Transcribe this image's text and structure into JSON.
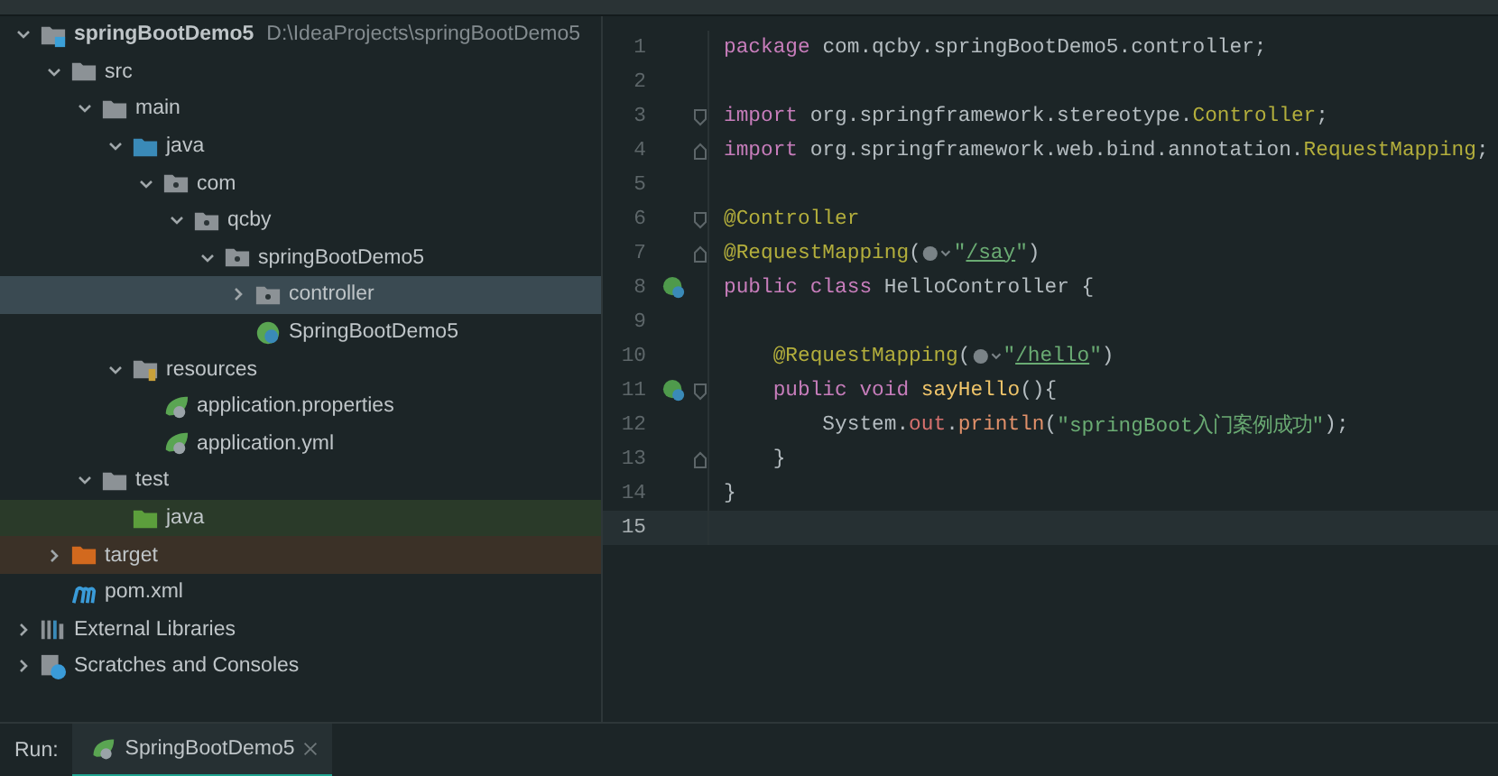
{
  "project_tree": {
    "items": [
      {
        "name": "springBootDemo5",
        "path": "D:\\IdeaProjects\\springBootDemo5",
        "kind": "module",
        "expanded": true,
        "selected": false,
        "children": [
          {
            "name": "src",
            "kind": "folder",
            "expanded": true,
            "selected": false,
            "children": [
              {
                "name": "main",
                "kind": "folder",
                "expanded": true,
                "selected": false,
                "children": [
                  {
                    "name": "java",
                    "kind": "source",
                    "expanded": true,
                    "selected": false,
                    "children": [
                      {
                        "name": "com",
                        "kind": "package",
                        "expanded": true,
                        "selected": false,
                        "children": [
                          {
                            "name": "qcby",
                            "kind": "package",
                            "expanded": true,
                            "selected": false,
                            "children": [
                              {
                                "name": "springBootDemo5",
                                "kind": "package",
                                "expanded": true,
                                "selected": false,
                                "children": [
                                  {
                                    "name": "controller",
                                    "kind": "package",
                                    "expanded": false,
                                    "selected": true
                                  },
                                  {
                                    "name": "SpringBootDemo5",
                                    "kind": "class",
                                    "selected": false
                                  }
                                ]
                              }
                            ]
                          }
                        ]
                      }
                    ]
                  },
                  {
                    "name": "resources",
                    "kind": "resources",
                    "expanded": true,
                    "selected": false,
                    "children": [
                      {
                        "name": "application.properties",
                        "kind": "config",
                        "selected": false
                      },
                      {
                        "name": "application.yml",
                        "kind": "config",
                        "selected": false
                      }
                    ]
                  }
                ]
              },
              {
                "name": "test",
                "kind": "folder",
                "expanded": true,
                "selected": false,
                "children": [
                  {
                    "name": "java",
                    "kind": "test-source",
                    "selected": false
                  }
                ]
              }
            ]
          },
          {
            "name": "target",
            "kind": "excluded",
            "expanded": false,
            "selected": false
          },
          {
            "name": "pom.xml",
            "kind": "maven",
            "selected": false
          }
        ]
      },
      {
        "name": "External Libraries",
        "kind": "libraries",
        "expanded": false,
        "selected": false
      },
      {
        "name": "Scratches and Consoles",
        "kind": "scratches",
        "expanded": false,
        "selected": false
      }
    ]
  },
  "editor": {
    "lines": [
      {
        "number": "1",
        "current": false,
        "tokens": [
          {
            "kind": "keyword",
            "text": "package"
          },
          {
            "kind": "plain",
            "text": " com.qcby.springBootDemo5.controller;"
          }
        ]
      },
      {
        "number": "2",
        "current": false
      },
      {
        "number": "3",
        "current": false,
        "fold_open": true,
        "tokens": [
          {
            "kind": "keyword",
            "text": "import"
          },
          {
            "kind": "plain",
            "text": " org.springframework.stereotype."
          },
          {
            "kind": "annotation",
            "text": "Controller"
          },
          {
            "kind": "plain",
            "text": ";"
          }
        ]
      },
      {
        "number": "4",
        "current": false,
        "fold_close": true,
        "tokens": [
          {
            "kind": "keyword",
            "text": "import"
          },
          {
            "kind": "plain",
            "text": " org.springframework.web.bind.annotation."
          },
          {
            "kind": "annotation",
            "text": "RequestMapping"
          },
          {
            "kind": "plain",
            "text": ";"
          }
        ]
      },
      {
        "number": "5",
        "current": false
      },
      {
        "number": "6",
        "current": false,
        "fold_open": true,
        "tokens": [
          {
            "kind": "annotation",
            "text": "@Controller"
          }
        ]
      },
      {
        "number": "7",
        "current": false,
        "fold_close": true,
        "tokens": [
          {
            "kind": "annotation",
            "text": "@RequestMapping"
          },
          {
            "kind": "plain",
            "text": "("
          },
          {
            "kind": "web-icon"
          },
          {
            "kind": "string",
            "text": "\""
          },
          {
            "kind": "url",
            "text": "/say"
          },
          {
            "kind": "string",
            "text": "\""
          },
          {
            "kind": "plain",
            "text": ")"
          }
        ]
      },
      {
        "number": "8",
        "current": false,
        "bean": true,
        "tokens": [
          {
            "kind": "keyword",
            "text": "public class"
          },
          {
            "kind": "plain",
            "text": " HelloController {"
          }
        ]
      },
      {
        "number": "9",
        "current": false
      },
      {
        "number": "10",
        "current": false,
        "tokens": [
          {
            "kind": "annotation",
            "text": "    @RequestMapping"
          },
          {
            "kind": "plain",
            "text": "("
          },
          {
            "kind": "web-icon"
          },
          {
            "kind": "string",
            "text": "\""
          },
          {
            "kind": "url",
            "text": "/hello"
          },
          {
            "kind": "string",
            "text": "\""
          },
          {
            "kind": "plain",
            "text": ")"
          }
        ]
      },
      {
        "number": "11",
        "current": false,
        "bean": true,
        "fold_open": true,
        "tokens": [
          {
            "kind": "keyword",
            "text": "    public void "
          },
          {
            "kind": "method",
            "text": "sayHello"
          },
          {
            "kind": "plain",
            "text": "(){"
          }
        ]
      },
      {
        "number": "12",
        "current": false,
        "tokens": [
          {
            "kind": "plain",
            "text": "        System."
          },
          {
            "kind": "field",
            "text": "out"
          },
          {
            "kind": "plain",
            "text": "."
          },
          {
            "kind": "call",
            "text": "println"
          },
          {
            "kind": "plain",
            "text": "("
          },
          {
            "kind": "string",
            "text": "\"springBoot入门案例成功\""
          },
          {
            "kind": "plain",
            "text": ");"
          }
        ]
      },
      {
        "number": "13",
        "current": false,
        "fold_close": true,
        "tokens": [
          {
            "kind": "plain",
            "text": "    }"
          }
        ]
      },
      {
        "number": "14",
        "current": false,
        "tokens": [
          {
            "kind": "plain",
            "text": "}"
          }
        ]
      },
      {
        "number": "15",
        "current": true
      }
    ]
  },
  "run_bar": {
    "label": "Run:",
    "tabs": [
      {
        "title": "SpringBootDemo5",
        "selected": true
      }
    ]
  }
}
